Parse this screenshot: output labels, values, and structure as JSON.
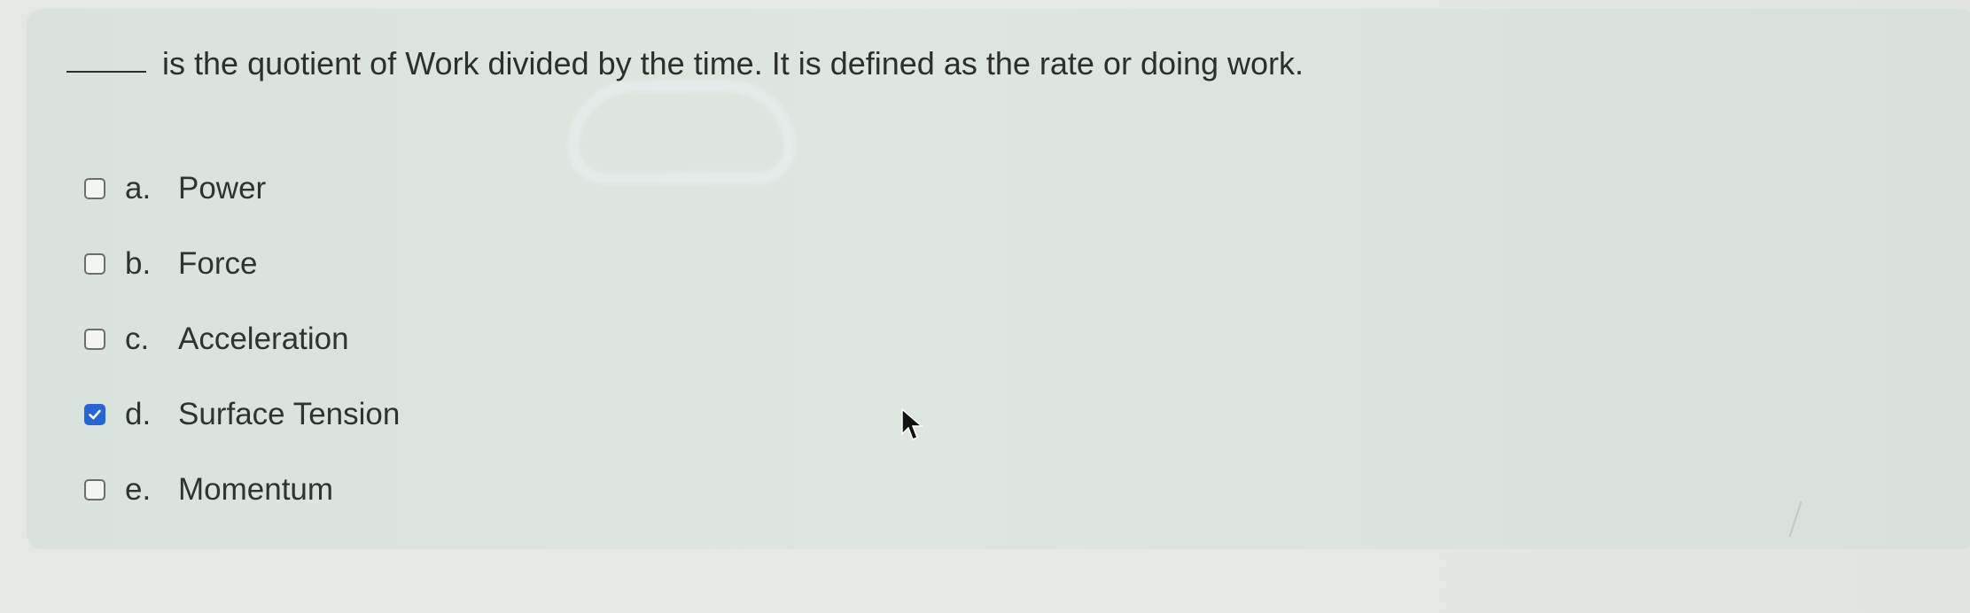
{
  "question": {
    "text": "is the quotient of Work divided by the time. It is defined as the rate or doing work."
  },
  "options": [
    {
      "letter": "a.",
      "text": "Power",
      "checked": false
    },
    {
      "letter": "b.",
      "text": "Force",
      "checked": false
    },
    {
      "letter": "c.",
      "text": "Acceleration",
      "checked": false
    },
    {
      "letter": "d.",
      "text": "Surface Tension",
      "checked": true
    },
    {
      "letter": "e.",
      "text": "Momentum",
      "checked": false
    }
  ],
  "colors": {
    "checked_fill": "#2465d8",
    "panel_background": "#dce5de",
    "text": "#2d2f2d"
  },
  "icons": {
    "checkbox_checked": "check-icon",
    "cursor": "mouse-pointer-icon"
  }
}
